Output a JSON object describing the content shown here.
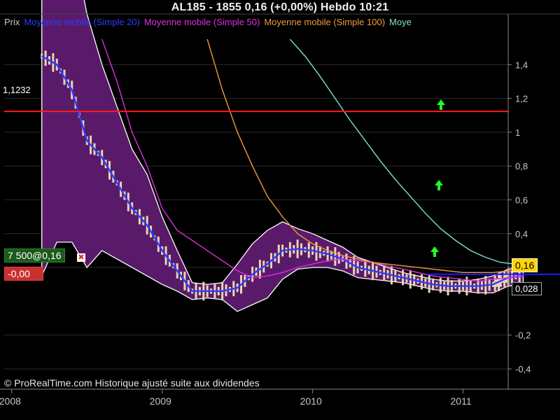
{
  "header": {
    "title": "AL185 - 1855     0,16 (+0,00%)     Hebdo  10:21"
  },
  "legend": [
    {
      "label": "Prix",
      "color": "#c8c8c8"
    },
    {
      "label": "Moyenne mobile (Simple 20)",
      "color": "#2b3cff"
    },
    {
      "label": "Moyenne mobile (Simple 50)",
      "color": "#e02ee0"
    },
    {
      "label": "Moyenne mobile (Simple 100)",
      "color": "#f09a3a"
    },
    {
      "label": "Moye",
      "color": "#7fe3cf"
    }
  ],
  "footer": {
    "text": "© ProRealTime.com Historique ajusté suite aux dividendes"
  },
  "order": {
    "label": "7 500@0,16",
    "pnl": "-0,00",
    "close_glyph": "✖"
  },
  "badges": {
    "last_price": "0,16",
    "low_value": "0,028",
    "resistance": "1,1232"
  },
  "chart_data": {
    "type": "line",
    "title": "AL185 - 1855",
    "xlabel": "",
    "ylabel": "",
    "x_ticks": [
      "2008",
      "2009",
      "2010",
      "2011"
    ],
    "y_ticks": [
      "1,4",
      "1,2",
      "1",
      "0,8",
      "0,6",
      "0,4",
      "0,2",
      "-0,2",
      "-0,4"
    ],
    "ylim": [
      -0.52,
      1.6
    ],
    "xlim": [
      2007.95,
      2011.3
    ],
    "grid": true,
    "horizontal_lines": [
      {
        "name": "resistance",
        "value": 1.1232,
        "color": "#ff1a1a"
      },
      {
        "name": "last",
        "value": 0.16,
        "color": "#1a1aff"
      }
    ],
    "series": [
      {
        "name": "Moyenne mobile (Simple 20)",
        "color": "#2b3cff",
        "x": [
          2008.2,
          2008.3,
          2008.4,
          2008.5,
          2008.6,
          2008.7,
          2008.8,
          2008.9,
          2009.0,
          2009.1,
          2009.2,
          2009.3,
          2009.4,
          2009.5,
          2009.6,
          2009.7,
          2009.8,
          2009.9,
          2010.0,
          2010.1,
          2010.2,
          2010.3,
          2010.4,
          2010.5,
          2010.6,
          2010.7,
          2010.8,
          2010.9,
          2011.0,
          2011.1,
          2011.2,
          2011.25,
          2011.3,
          2011.4
        ],
        "y": [
          1.45,
          1.4,
          1.25,
          0.95,
          0.85,
          0.7,
          0.55,
          0.45,
          0.3,
          0.18,
          0.06,
          0.06,
          0.06,
          0.08,
          0.16,
          0.22,
          0.3,
          0.31,
          0.3,
          0.28,
          0.25,
          0.2,
          0.18,
          0.16,
          0.14,
          0.12,
          0.1,
          0.09,
          0.09,
          0.09,
          0.1,
          0.12,
          0.14,
          0.15
        ]
      },
      {
        "name": "Moyenne mobile (Simple 50)",
        "color": "#e02ee0",
        "x": [
          2008.6,
          2008.7,
          2008.8,
          2008.9,
          2009.0,
          2009.1,
          2009.2,
          2009.3,
          2009.4,
          2009.5,
          2009.6,
          2009.7,
          2009.8,
          2009.9,
          2010.0,
          2010.1,
          2010.2,
          2010.3,
          2010.4,
          2010.5,
          2010.6,
          2010.7,
          2010.8,
          2010.9,
          2011.0,
          2011.1,
          2011.2,
          2011.3,
          2011.4
        ],
        "y": [
          1.55,
          1.3,
          1.0,
          0.8,
          0.55,
          0.42,
          0.36,
          0.3,
          0.24,
          0.18,
          0.14,
          0.15,
          0.17,
          0.2,
          0.22,
          0.24,
          0.25,
          0.24,
          0.23,
          0.21,
          0.19,
          0.17,
          0.15,
          0.14,
          0.13,
          0.12,
          0.13,
          0.14,
          0.15
        ]
      },
      {
        "name": "Moyenne mobile (Simple 100)",
        "color": "#f09a3a",
        "x": [
          2009.3,
          2009.4,
          2009.5,
          2009.6,
          2009.7,
          2009.8,
          2009.9,
          2010.0,
          2010.1,
          2010.2,
          2010.3,
          2010.4,
          2010.5,
          2010.6,
          2010.7,
          2010.8,
          2010.9,
          2011.0,
          2011.1,
          2011.2,
          2011.3,
          2011.4
        ],
        "y": [
          1.55,
          1.25,
          1.0,
          0.8,
          0.62,
          0.5,
          0.4,
          0.34,
          0.3,
          0.27,
          0.25,
          0.23,
          0.22,
          0.21,
          0.2,
          0.19,
          0.18,
          0.17,
          0.17,
          0.17,
          0.18,
          0.18
        ]
      },
      {
        "name": "Moye",
        "color": "#7fe3cf",
        "x": [
          2009.85,
          2009.95,
          2010.05,
          2010.15,
          2010.25,
          2010.35,
          2010.45,
          2010.55,
          2010.65,
          2010.75,
          2010.85,
          2010.95,
          2011.05,
          2011.15,
          2011.25,
          2011.35,
          2011.45
        ],
        "y": [
          1.55,
          1.45,
          1.33,
          1.2,
          1.07,
          0.95,
          0.83,
          0.72,
          0.62,
          0.52,
          0.43,
          0.36,
          0.3,
          0.26,
          0.23,
          0.22,
          0.22
        ]
      }
    ]
  }
}
